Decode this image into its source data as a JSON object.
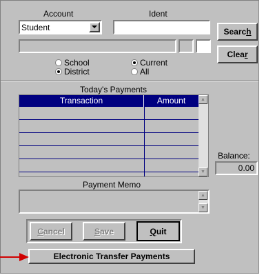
{
  "account": {
    "label": "Account",
    "value": "Student",
    "ident_label": "Ident",
    "ident_value": ""
  },
  "buttons": {
    "search": "Search",
    "search_ul": "h",
    "clear": "Clear",
    "clear_ul": "r",
    "cancel": "Cancel",
    "save": "Save",
    "quit": "Quit",
    "electronic": "Electronic Transfer Payments"
  },
  "scope": {
    "school": "School",
    "district": "District",
    "current": "Current",
    "all": "All",
    "selected_scope": "District",
    "selected_period": "Current"
  },
  "payments": {
    "title": "Today's Payments",
    "columns": [
      "Transaction",
      "Amount"
    ],
    "rows": [
      [
        "",
        ""
      ],
      [
        "",
        ""
      ],
      [
        "",
        ""
      ],
      [
        "",
        ""
      ],
      [
        "",
        ""
      ],
      [
        "",
        ""
      ]
    ]
  },
  "balance": {
    "label": "Balance:",
    "value": "0.00"
  },
  "memo": {
    "label": "Payment Memo",
    "value": ""
  },
  "colors": {
    "header": "#000080",
    "arrow": "#d00000",
    "face": "#c0c0c0"
  }
}
